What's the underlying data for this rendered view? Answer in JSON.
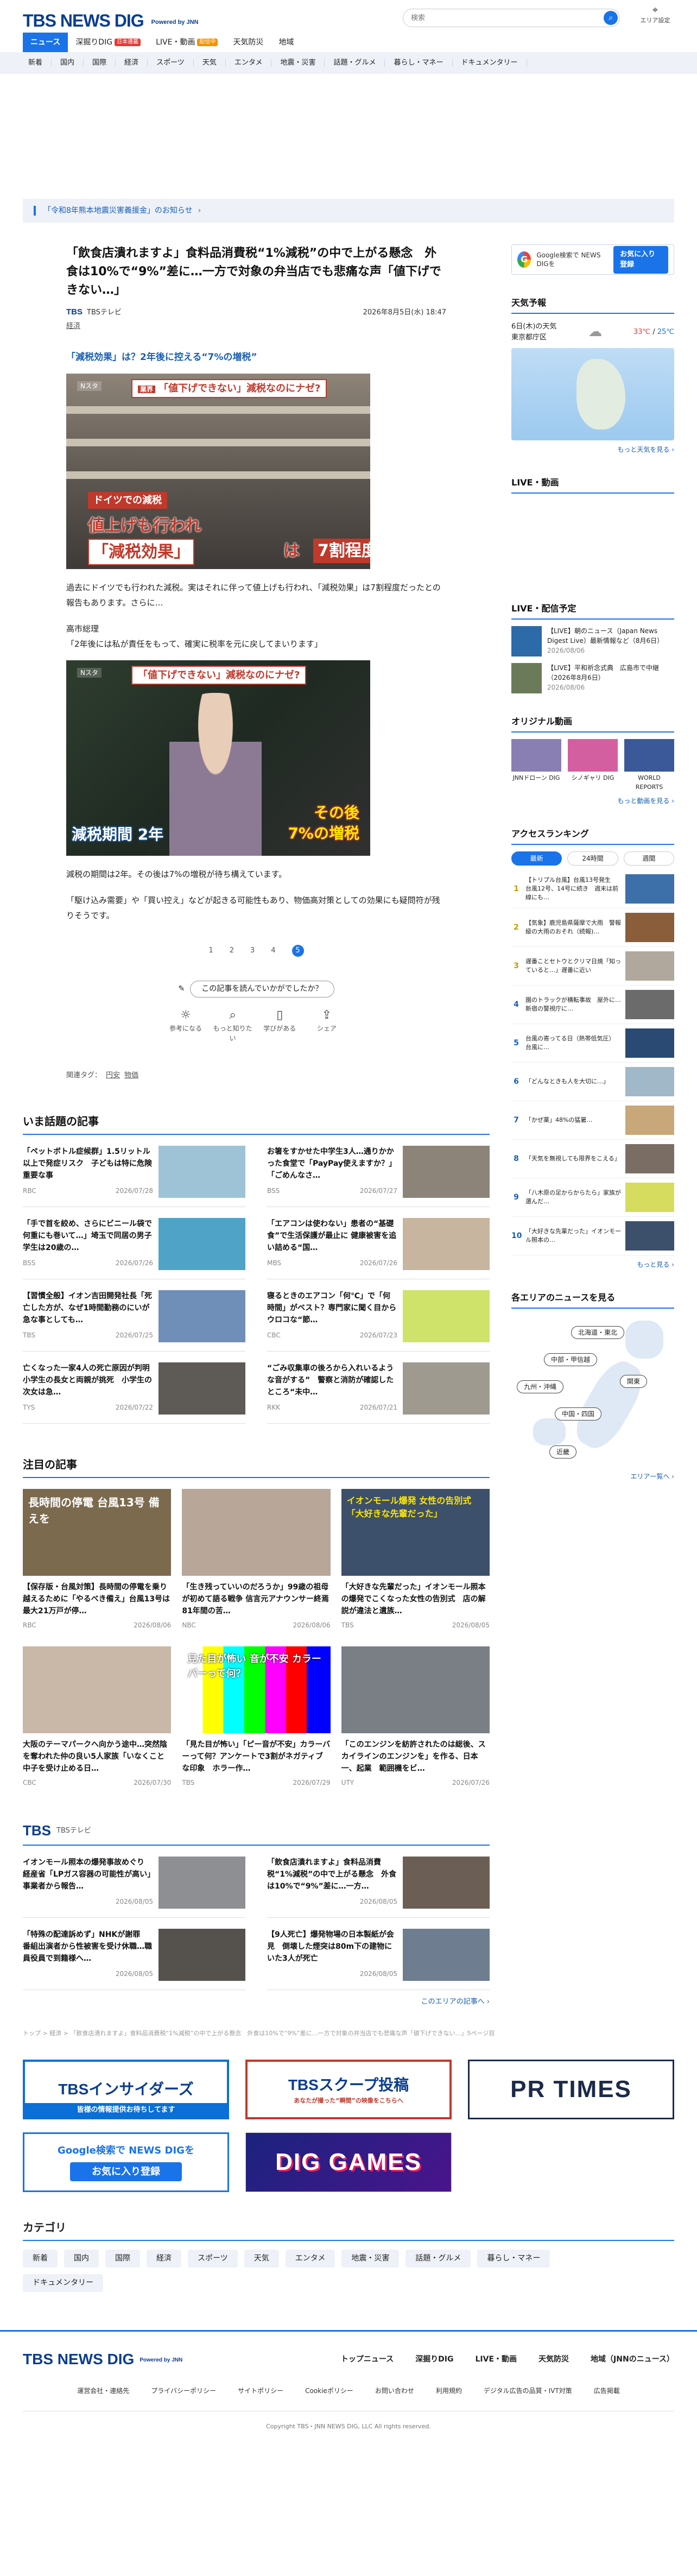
{
  "header": {
    "logo": "TBS NEWS DIG",
    "powered": "Powered by JNN",
    "search_placeholder": "検索",
    "area_label": "エリア設定"
  },
  "gnav": [
    {
      "label": "ニュース",
      "active": true,
      "badge": ""
    },
    {
      "label": "深掘りDIG",
      "active": false,
      "badge": "日本連載"
    },
    {
      "label": "LIVE・動画",
      "active": false,
      "badge": "配信中"
    },
    {
      "label": "天気防災",
      "active": false,
      "badge": ""
    },
    {
      "label": "地域",
      "active": false,
      "badge": ""
    }
  ],
  "subnav": [
    "新着",
    "国内",
    "国際",
    "経済",
    "スポーツ",
    "天気",
    "エンタメ",
    "地震・災害",
    "話題・グルメ",
    "暮らし・マネー",
    "ドキュメンタリー"
  ],
  "notice": "「令和8年熊本地震災害義援金」のお知らせ",
  "article": {
    "title": "「飲食店潰れますよ」食料品消費税“1%減税”の中で上がる懸念　外食は10%で“9%”差に…一方で対象の弁当店でも悲痛な声「値下げできない…」",
    "source": "TBSテレビ",
    "datetime": "2026年8月5日(水) 18:47",
    "category": "経済",
    "lead": "「減税効果」は？2年後に控える“7%の増税”",
    "photo1": {
      "news_logo": "Nスタ",
      "cap_label": "業界",
      "cap_main": "「値下げできない」減税なのにナゼ?",
      "cap_de": "ドイツでの減税",
      "cap_big": "値上げも行われ",
      "cap_big2": "「減税効果」",
      "cap_wa": "は",
      "cap_box": "7割程度"
    },
    "para1": "過去にドイツでも行われた減税。実はそれに伴って値上げも行われ、「減税効果」は7割程度だったとの報告もあります。さらに…",
    "para2_speaker": "高市総理",
    "para2": "「2年後には私が責任をもって、確実に税率を元に戻してまいります」",
    "photo2": {
      "news_logo": "Nスタ",
      "cap_main": "「値下げできない」減税なのにナゼ?",
      "cap_2y": "減税期間 2年",
      "cap_7a": "その後",
      "cap_7b": "7%の増税"
    },
    "para3": "減税の期間は2年。その後は7%の増税が待ち構えています。",
    "para4": "「駆け込み需要」や「買い控え」などが起きる可能性もあり、物価高対策としての効果にも疑問符が残りそうです。",
    "pages": [
      "1",
      "2",
      "3",
      "4",
      "5"
    ],
    "current_page": "5",
    "feedback_q": "この記事を読んでいかがでしたか？",
    "feedback": [
      "参考になる",
      "もっと知りたい",
      "学びがある",
      "シェア"
    ],
    "tags_label": "関連タグ：",
    "tags": [
      "円安",
      "物価"
    ]
  },
  "hot": {
    "title": "いま話題の記事",
    "items": [
      {
        "t": "「ペットボトル症候群」1.5リットル以上で発症リスク　子どもは特に危険　重要な事",
        "src": "RBC",
        "date": "2026/07/28"
      },
      {
        "t": "お箸をすかせた中学生3人…通りかかった食堂で「PayPay使えますか？」「ごめんなさ…",
        "src": "BSS",
        "date": "2026/07/27"
      },
      {
        "t": "「手で首を絞め、さらにビニール袋で何重にも巻いて…」埼玉で同居の男子学生は20歳の…",
        "src": "BSS",
        "date": "2026/07/26"
      },
      {
        "t": "「エアコンは使わない」患者の“基礎食”で生活保護が最止に 健康被害を追い詰める“国…",
        "src": "MBS",
        "date": "2026/07/26"
      },
      {
        "t": "【習慣全般】イオン吉田開発社長「死亡した方が、なぜ1時間勤務のにいが急な事としても…",
        "src": "TBS",
        "date": "2026/07/25"
      },
      {
        "t": "寝るときのエアコン「何℃」で「何時間」がベスト？専門家に聞く目からウロコな“節…",
        "src": "CBC",
        "date": "2026/07/23"
      },
      {
        "t": "亡くなった一家4人の死亡原因が判明　小学生の長女と両親が挑死　小学生の次女は急…",
        "src": "TYS",
        "date": "2026/07/22"
      },
      {
        "t": "“ごみ収集車の後ろから入れいるような音がする”　警察と消防が確認したところ“未中…",
        "src": "RKK",
        "date": "2026/07/21"
      }
    ]
  },
  "featured": {
    "title": "注目の記事",
    "items": [
      {
        "t": "【保存版・台風対策】長時間の停電を乗り越えるために「やるべき備え」台風13号は最大21万戸が停…",
        "src": "RBC",
        "date": "2026/08/06",
        "img_text": "長時間の停電 台風13号 備えを"
      },
      {
        "t": "「生き残っていいのだろうか」99歳の祖母が初めて語る戦争 信言元アナウンサー終焉81年間の苦…",
        "src": "NBC",
        "date": "2026/08/06",
        "img_text": ""
      },
      {
        "t": "「大好きな先輩だった」イオンモール照本の爆発でこくなった女性の告別式　店の解説が違法と遺族…",
        "src": "TBS",
        "date": "2026/08/05",
        "img_text": "イオンモール爆発 女性の告別式「大好きな先輩だった」"
      },
      {
        "t": "大阪のテーマパークへ向かう途中…突然陰を奪われた仲の良い5人家族「いなくこと中子を受け止める日…",
        "src": "CBC",
        "date": "2026/07/30",
        "img_text": ""
      },
      {
        "t": "「見た目が怖い」「ピー音が不安」カラーバーって何？アンケートで3割がネガティブな印象　ホラー作…",
        "src": "TBS",
        "date": "2026/07/29",
        "img_text": "見た目が怖い 音が不安 カラーバーって何？"
      },
      {
        "t": "「このエンジンを紡許されたのは総後、スカイラインのエンジンを」を作る、日本一、起業　範囲機をビ…",
        "src": "UTY",
        "date": "2026/07/26",
        "img_text": ""
      }
    ]
  },
  "tbs_sec": {
    "logo": "TBS",
    "sub": "TBSテレビ",
    "items": [
      {
        "t": "イオンモール照本の爆発事故めぐり　経産省「LPガス容器の可能性が高い」事業者から報告…",
        "date": "2026/08/05"
      },
      {
        "t": "「飲食店潰れますよ」食料品消費税“1%減税”の中で上がる懸念　外食は10%で“9%”差に…一方…",
        "date": "2026/08/05"
      },
      {
        "t": "「特殊の配達訴めず」NHKが謝罪　番組出演者から性被害を受け休職…職員役員で到籍様へ…",
        "date": "2026/08/05"
      },
      {
        "t": "【9人死亡】爆発物場の日本製紙が会見　倒壊した煙突は80m下の建物にいた3人が死亡",
        "date": "2026/08/05"
      }
    ],
    "more": "このエリアの記事へ ›"
  },
  "sidebar": {
    "gbtn_text": "Google検索で NEWS DIGを",
    "gbtn_reg": "お気に入り登録",
    "weather_h": "天気予報",
    "weather_date": "6日(木)の天気",
    "weather_place": "東京都庁区",
    "weather_hi": "33℃",
    "weather_sep": "/",
    "weather_lo": "25℃",
    "weather_more": "もっと天気を見る ›",
    "live_h": "LIVE・動画",
    "live_more": "",
    "sched_h": "LIVE・配信予定",
    "sched": [
      {
        "t": "【LIVE】朝のニュース（Japan News Digest Live）最新情報など（8月6日）",
        "d": "2026/08/06"
      },
      {
        "t": "【LIVE】平和祈念式典　広島市で中継（2026年8月6日）",
        "d": "2026/08/06"
      }
    ],
    "orig_h": "オリジナル動画",
    "orig": [
      "JNNドローン DIG",
      "シノギャリ DIG",
      "WORLD REPORTS"
    ],
    "orig_more": "もっと動画を見る ›",
    "rank_h": "アクセスランキング",
    "rank_tabs": [
      "最新",
      "24時間",
      "週間"
    ],
    "rank": [
      "【トリプル台風】台風13号発生　台風12号、14号に続き　週末は前線にも…",
      "【気象】鹿児島県薩摩で大雨　警報級の大雨のおそれ（続報)…",
      "遅番ことセトウとクリマ日焼「知っていると…」遅番に近い",
      "園のトラックが横転事故　屋外に…新宿の警視庁に…",
      "台風の寄ってる日（熱帯低気圧）　台風に…",
      "「どんなときも人を大切に…」",
      "「かぜ薬」48%の猛暑…",
      "「天気を無視しても限界をこえる」",
      "「八木原の足からからたら」家族が選んだ…",
      "「大好きな先輩だった」イオンモール照本の…"
    ],
    "rank_more": "もっと見る ›",
    "area_h": "各エリアのニュースを見る",
    "areas": [
      "北海道・東北",
      "関東",
      "中部・甲信越",
      "九州・沖縄",
      "中国・四国",
      "近畿"
    ],
    "area_more": "エリア一覧へ ›"
  },
  "breadcrumb": "トップ > 経済 > 「飲食店潰れますよ」食料品消費税“1%減税”の中で上がる懸念　外食は10%で“9%”差に…一方で対象の弁当店でも悲痛な声「値下げできない…」5ページ目",
  "banners": {
    "b1_t": "TBSインサイダーズ",
    "b1_s": "皆様の情報提供お待ちしてます",
    "b2_t": "TBSスクープ投稿",
    "b2_s": "あなたが撮った“瞬間”の映像をこちらへ",
    "b3": "PR TIMES",
    "b4_t": "Google検索で NEWS DIGを",
    "b4_s": "お気に入り登録",
    "b5": "DIG GAMES"
  },
  "categories": {
    "title": "カテゴリ",
    "items": [
      "新着",
      "国内",
      "国際",
      "経済",
      "スポーツ",
      "天気",
      "エンタメ",
      "地震・災害",
      "話題・グルメ",
      "暮らし・マネー",
      "ドキュメンタリー"
    ]
  },
  "footer": {
    "logo": "TBS NEWS DIG",
    "powered": "Powered by JNN",
    "nav": [
      "トップニュース",
      "深掘りDIG",
      "LIVE・動画",
      "天気防災",
      "地域（JNNのニュース）"
    ],
    "links": [
      "運営会社・連絡先",
      "プライバシーポリシー",
      "サイトポリシー",
      "Cookieポリシー",
      "お問い合わせ",
      "利用規約",
      "デジタル広告の品質・IVT対策",
      "広告掲載"
    ],
    "copyright": "Copyright TBS・JNN NEWS DIG, LLC All rights reserved."
  }
}
